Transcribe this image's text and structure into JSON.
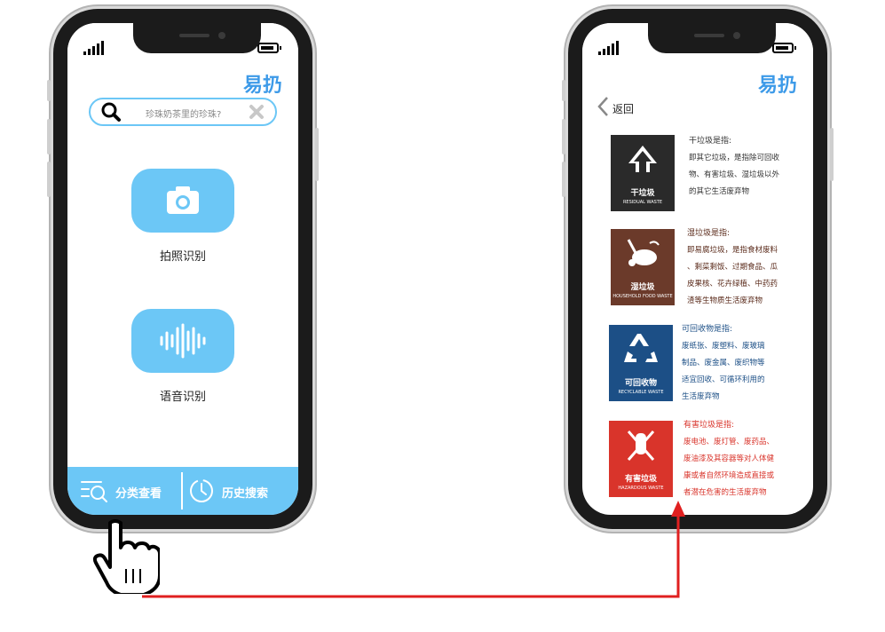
{
  "left_screen": {
    "brand": "易扔",
    "search": {
      "placeholder": "珍珠奶茶里的珍珠?"
    },
    "features": [
      {
        "label": "拍照识别",
        "icon": "camera-icon"
      },
      {
        "label": "语音识别",
        "icon": "voice-wave-icon"
      }
    ],
    "bottom_nav": [
      {
        "label": "分类查看",
        "icon": "category-search-icon"
      },
      {
        "label": "历史搜索",
        "icon": "clock-history-icon"
      }
    ]
  },
  "right_screen": {
    "brand": "易扔",
    "back_label": "返回",
    "categories": [
      {
        "name_cn": "干垃圾",
        "name_en": "RESIDUAL WASTE",
        "heading": "干垃圾是指:",
        "lines": [
          "即其它垃圾，是指除可回收",
          "物、有害垃圾、湿垃圾以外",
          "的其它生活废弃物"
        ],
        "bg_color": "#2a2a2a",
        "text_color": "#333333"
      },
      {
        "name_cn": "湿垃圾",
        "name_en": "HOUSEHOLD FOOD WASTE",
        "heading": "湿垃圾是指:",
        "lines": [
          "即易腐垃圾，是指食材废料",
          "、剩菜剩饭、过期食品、瓜",
          "皮果核、花卉绿植、中药药",
          "渣等生物质生活废弃物"
        ],
        "bg_color": "#6b3a2a",
        "text_color": "#5a2a1a"
      },
      {
        "name_cn": "可回收物",
        "name_en": "RECYCLABLE WASTE",
        "heading": "可回收物是指:",
        "lines": [
          "废纸张、废塑料、废玻璃",
          "制品、废金属、废织物等",
          "适宜回收、可循环利用的",
          "生活废弃物"
        ],
        "bg_color": "#1c4f86",
        "text_color": "#1c4f86"
      },
      {
        "name_cn": "有害垃圾",
        "name_en": "HAZARDOUS WASTE",
        "heading": "有害垃圾是指:",
        "lines": [
          "废电池、废灯管、废药品、",
          "废油漆及其容器等对人体健",
          "康或者自然环境造成直接或",
          "者潜在危害的生活废弃物"
        ],
        "bg_color": "#d9342b",
        "text_color": "#d9342b"
      }
    ]
  },
  "colors": {
    "accent": "#6cc7f6",
    "brand": "#3d9ae8",
    "flow_arrow": "#e02020"
  }
}
